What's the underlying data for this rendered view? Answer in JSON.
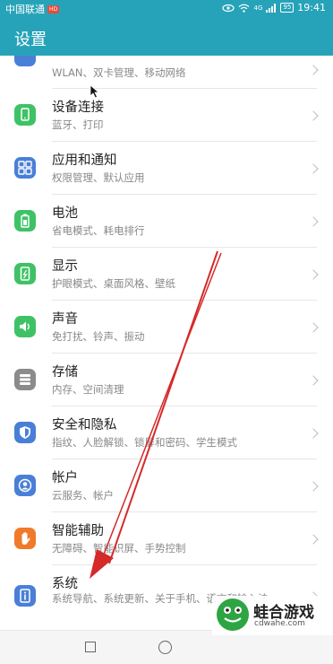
{
  "status_bar": {
    "carrier": "中国联通",
    "carrier_badge": "HD",
    "network": "4G",
    "battery": "95",
    "time": "19:41"
  },
  "header": {
    "title": "设置"
  },
  "settings": [
    {
      "id": "network",
      "title": "",
      "subtitle": "WLAN、双卡管理、移动网络",
      "icon": "network-icon",
      "color": "#4a7fd8"
    },
    {
      "id": "devices",
      "title": "设备连接",
      "subtitle": "蓝牙、打印",
      "icon": "device-connect-icon",
      "color": "#3fc266"
    },
    {
      "id": "apps",
      "title": "应用和通知",
      "subtitle": "权限管理、默认应用",
      "icon": "apps-grid-icon",
      "color": "#4a7fd8"
    },
    {
      "id": "battery",
      "title": "电池",
      "subtitle": "省电模式、耗电排行",
      "icon": "battery-icon",
      "color": "#3fc266"
    },
    {
      "id": "display",
      "title": "显示",
      "subtitle": "护眼模式、桌面风格、壁纸",
      "icon": "display-icon",
      "color": "#3fc266"
    },
    {
      "id": "sound",
      "title": "声音",
      "subtitle": "免打扰、铃声、振动",
      "icon": "speaker-icon",
      "color": "#3fc266"
    },
    {
      "id": "storage",
      "title": "存储",
      "subtitle": "内存、空间清理",
      "icon": "storage-icon",
      "color": "#8b8b8b"
    },
    {
      "id": "security",
      "title": "安全和隐私",
      "subtitle": "指纹、人脸解锁、锁屏和密码、学生模式",
      "icon": "shield-icon",
      "color": "#4a7fd8"
    },
    {
      "id": "accounts",
      "title": "帐户",
      "subtitle": "云服务、帐户",
      "icon": "account-icon",
      "color": "#4a7fd8"
    },
    {
      "id": "accessibility",
      "title": "智能辅助",
      "subtitle": "无障碍、智能识屏、手势控制",
      "icon": "hand-icon",
      "color": "#f07a2a"
    },
    {
      "id": "system",
      "title": "系统",
      "subtitle": "系统导航、系统更新、关于手机、语言和输入法",
      "icon": "system-info-icon",
      "color": "#4a7fd8"
    }
  ],
  "watermark": {
    "title": "蛙合游戏",
    "url": "cdwahe.com"
  },
  "accent": "#27a3b9",
  "annotation_color": "#d42a2a"
}
